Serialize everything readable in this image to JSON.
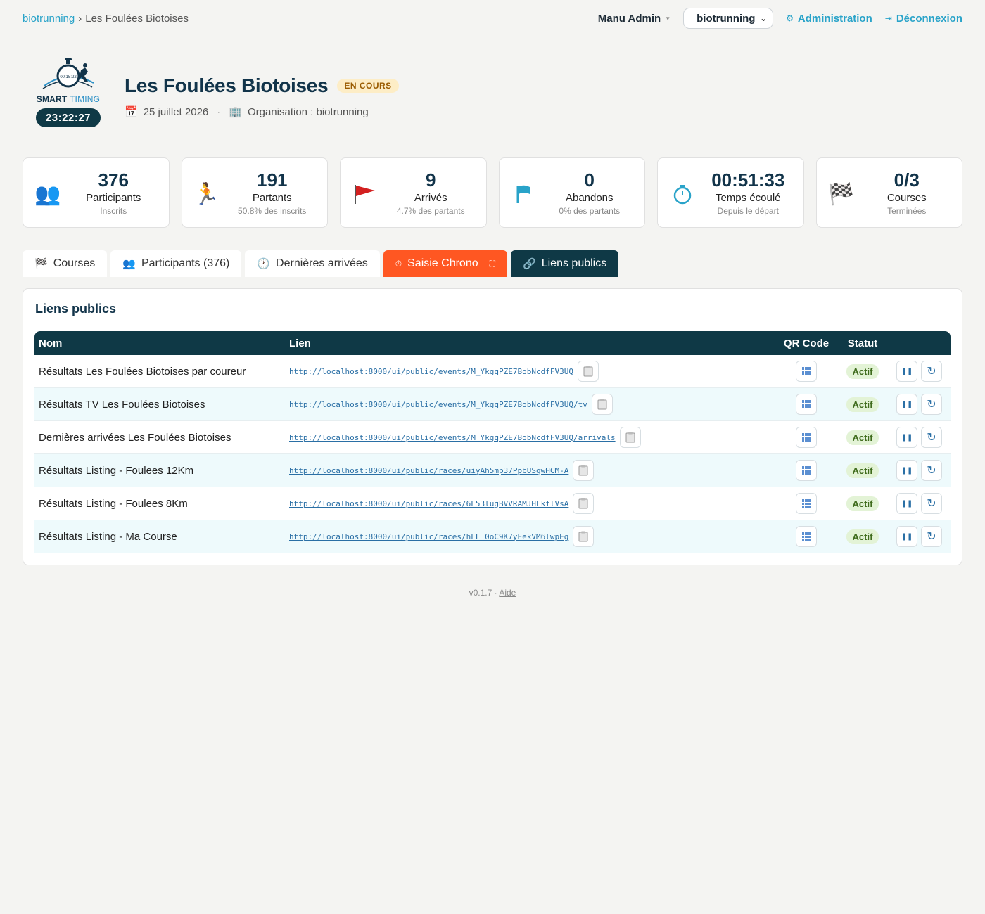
{
  "breadcrumb": {
    "root": "biotrunning",
    "separator": "›",
    "current": "Les Foulées Biotoises"
  },
  "topbar": {
    "user": "Manu Admin",
    "org_select": "biotrunning",
    "admin_link": "Administration",
    "logout_link": "Déconnexion"
  },
  "logo": {
    "word1": "SMART",
    "word2": "TIMING",
    "clock": "23:22:27"
  },
  "event": {
    "title": "Les Foulées Biotoises",
    "status": "EN COURS",
    "date": "25 juillet 2026",
    "organisation": "Organisation : biotrunning"
  },
  "stats": [
    {
      "value": "376",
      "label": "Participants",
      "sub": "Inscrits",
      "icon": "people-icon"
    },
    {
      "value": "191",
      "label": "Partants",
      "sub": "50.8% des inscrits",
      "icon": "runner-icon"
    },
    {
      "value": "9",
      "label": "Arrivés",
      "sub": "4.7% des partants",
      "icon": "red-flag-icon"
    },
    {
      "value": "0",
      "label": "Abandons",
      "sub": "0% des partants",
      "icon": "blue-flag-icon"
    },
    {
      "value": "00:51:33",
      "label": "Temps écoulé",
      "sub": "Depuis le départ",
      "icon": "stopwatch-icon"
    },
    {
      "value": "0/3",
      "label": "Courses",
      "sub": "Terminées",
      "icon": "checkered-flag-icon"
    }
  ],
  "tabs": {
    "courses": "Courses",
    "participants": "Participants (376)",
    "arrivals": "Dernières arrivées",
    "chrono": "Saisie Chrono",
    "public_links": "Liens publics"
  },
  "panel": {
    "title": "Liens publics",
    "columns": {
      "name": "Nom",
      "link": "Lien",
      "qr": "QR Code",
      "status": "Statut"
    },
    "rows": [
      {
        "name": "Résultats Les Foulées Biotoises par coureur",
        "url": "http://localhost:8000/ui/public/events/M_YkgqPZE7BobNcdfFV3UQ",
        "status": "Actif"
      },
      {
        "name": "Résultats TV Les Foulées Biotoises",
        "url": "http://localhost:8000/ui/public/events/M_YkgqPZE7BobNcdfFV3UQ/tv",
        "status": "Actif"
      },
      {
        "name": "Dernières arrivées Les Foulées Biotoises",
        "url": "http://localhost:8000/ui/public/events/M_YkgqPZE7BobNcdfFV3UQ/arrivals",
        "status": "Actif"
      },
      {
        "name": "Résultats Listing - Foulees 12Km",
        "url": "http://localhost:8000/ui/public/races/uiyAh5mp37PpbUSqwHCM-A",
        "status": "Actif"
      },
      {
        "name": "Résultats Listing - Foulees 8Km",
        "url": "http://localhost:8000/ui/public/races/6L53lugBVVRAMJHLkflVsA",
        "status": "Actif"
      },
      {
        "name": "Résultats Listing - Ma Course",
        "url": "http://localhost:8000/ui/public/races/hLL_0oC9K7yEekVM6lwpEg",
        "status": "Actif"
      }
    ]
  },
  "footer": {
    "version": "v0.1.7 ·",
    "help": "Aide"
  },
  "colors": {
    "accent": "#29a3c9",
    "header_dark": "#0f3946",
    "chrono": "#ff5722",
    "status_bg": "#fdedc6"
  }
}
